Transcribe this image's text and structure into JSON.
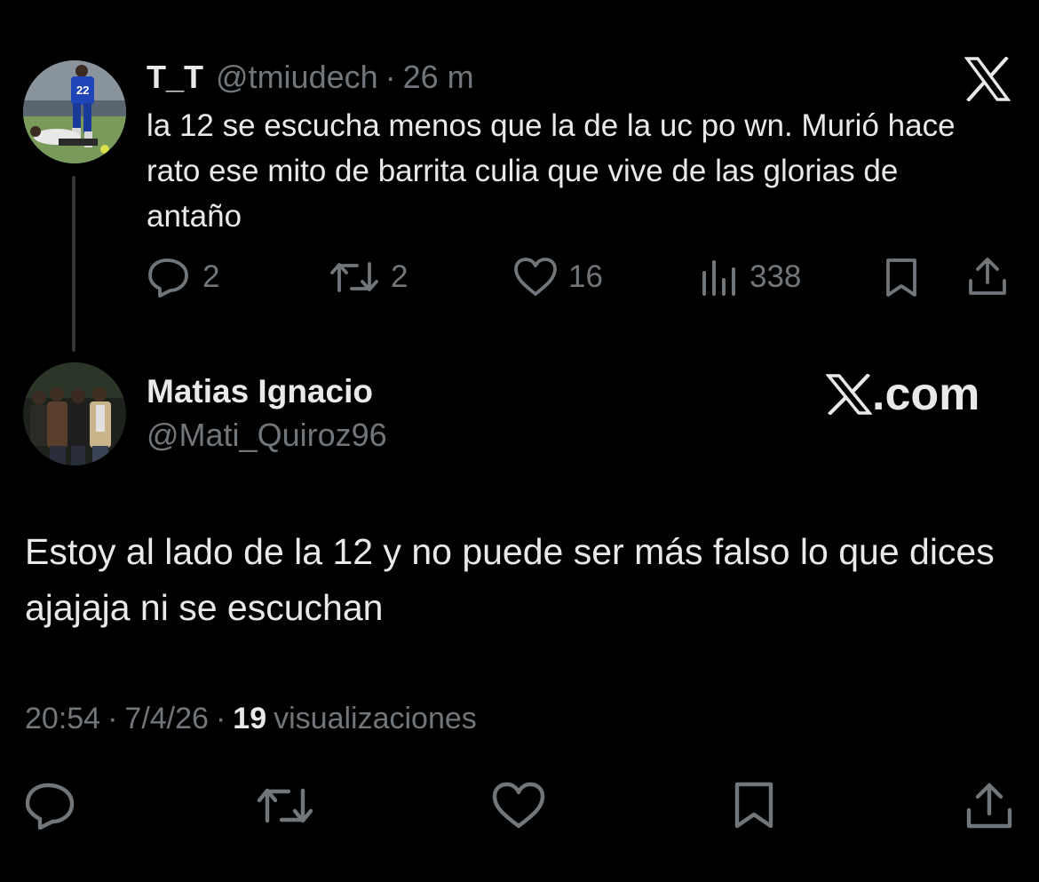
{
  "parent_tweet": {
    "display_name": "T_T",
    "handle": "@tmiudech",
    "separator": "·",
    "time_ago": "26 m",
    "text": "la 12 se escucha menos que la de la uc po wn. Murió hace rato ese mito de barrita culia que vive de las glorias de antaño",
    "metrics": {
      "replies": "2",
      "reposts": "2",
      "likes": "16",
      "views": "338"
    },
    "brand_icon": "x-logo-icon"
  },
  "reply_tweet": {
    "display_name": "Matias Ignacio",
    "handle": "@Mati_Quiroz96",
    "watermark": ".com",
    "text": "Estoy al lado de la 12 y no puede ser más falso lo que dices ajajaja ni se escuchan",
    "time": "20:54",
    "separator": "·",
    "date": "7/4/26",
    "views_count": "19",
    "views_label": "visualizaciones"
  },
  "colors": {
    "background": "#000000",
    "primary_text": "#e7e9ea",
    "secondary_text": "#71767b",
    "thread_line": "#333639"
  },
  "icons": [
    "reply-icon",
    "repost-icon",
    "like-icon",
    "views-icon",
    "bookmark-icon",
    "share-icon",
    "x-logo-icon"
  ]
}
